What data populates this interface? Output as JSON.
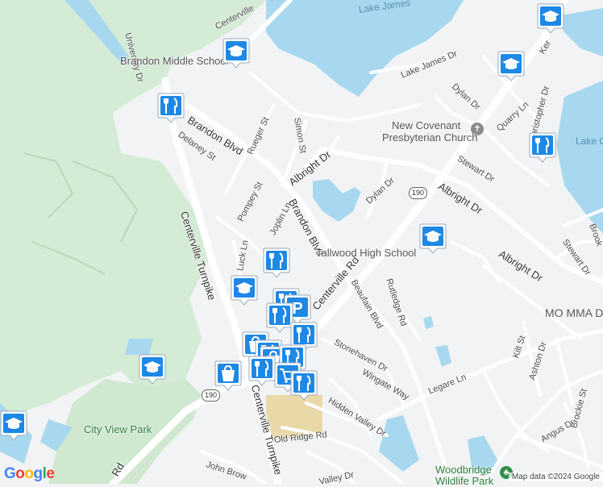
{
  "map": {
    "water_labels": {
      "lake_james": "Lake James",
      "lake_right": "Lake C"
    },
    "roads": {
      "centerville_top": "Centerville",
      "university_dr": "University Dr",
      "lake_james_dr": "Lake James Dr",
      "dylan_dr_top": "Dylan Dr",
      "quarry_ln": "Quarry Ln",
      "christopher_dr": "Christopher Dr",
      "kem": "Ker",
      "brandon_blvd_upper": "Brandon Blvd",
      "rueger_st": "Rueger St",
      "simon_st": "Simon St",
      "delaney_st": "Delaney St",
      "albright_dr_left": "Albright Dr",
      "stewart_dr_top": "Stewart Dr",
      "albright_dr_right": "Albright Dr",
      "albright_dr_right2": "Albright Dr",
      "brookfield": "Brook",
      "stewart_dr_right": "Stewart Dr",
      "dylan_dr_mid": "Dylan Dr",
      "pompey_st": "Pompey St",
      "brandon_blvd_lower": "Brandon Blvd",
      "joplin_ln": "Joplin Ln",
      "luck_ln": "Luck Ln",
      "centerville_tpke_left": "Centerville Turnpike",
      "centerville_rd": "Centerville Rd",
      "beaufain_blvd": "Beaufain Blvd",
      "rutledge_rd": "Rutledge Rd",
      "stonehaven_dr": "Stonehaven Dr",
      "wingate_way": "Wingate Way",
      "kilt_st": "Kilt St",
      "ashton_dr": "Ashton Dr",
      "legare_ln": "Legare Ln",
      "hidden_valley_dr": "Hidden Valley Dr",
      "centerville_tpke_lower": "Centerville Turnpike",
      "old_ridge_rd": "Old Ridge Rd",
      "angus_dr": "Angus Dr",
      "brockie_st": "Brockie St",
      "john_brown": "John Brow",
      "valley_dr_bottom": "Valley Dr",
      "road_bottom_left": "Rd",
      "route_190_a": "190",
      "route_190_b": "190"
    },
    "places": {
      "brandon_middle": "Brandon Middle School",
      "new_covenant_1": "New Covenant",
      "new_covenant_2": "Presbyterian Church",
      "tallwood_high": "Tallwood High School",
      "mo_mma": "MO MMA D",
      "city_view_park": "City View Park",
      "woodbridge_1": "Woodbridge",
      "woodbridge_2": "Wildlife Park"
    },
    "pins": [
      {
        "type": "school"
      },
      {
        "type": "school"
      },
      {
        "type": "school"
      },
      {
        "type": "restaurant"
      },
      {
        "type": "restaurant"
      },
      {
        "type": "school"
      },
      {
        "type": "restaurant"
      },
      {
        "type": "school"
      },
      {
        "type": "restaurant"
      },
      {
        "type": "parking"
      },
      {
        "type": "restaurant"
      },
      {
        "type": "restaurant"
      },
      {
        "type": "shopping"
      },
      {
        "type": "restaurant"
      },
      {
        "type": "shopping"
      },
      {
        "type": "restaurant"
      },
      {
        "type": "school"
      },
      {
        "type": "shopping"
      },
      {
        "type": "restaurant"
      },
      {
        "type": "shopping-cart"
      },
      {
        "type": "restaurant"
      },
      {
        "type": "school"
      }
    ]
  },
  "footer": {
    "logo_text": "Google",
    "attribution": "Map data ©2024 Google"
  },
  "colors": {
    "water": "#a8d8f0",
    "park": "#c8e6c9",
    "land": "#f2f3f4",
    "road_major": "#ffffff",
    "pin_fill": "#1e88e5"
  }
}
